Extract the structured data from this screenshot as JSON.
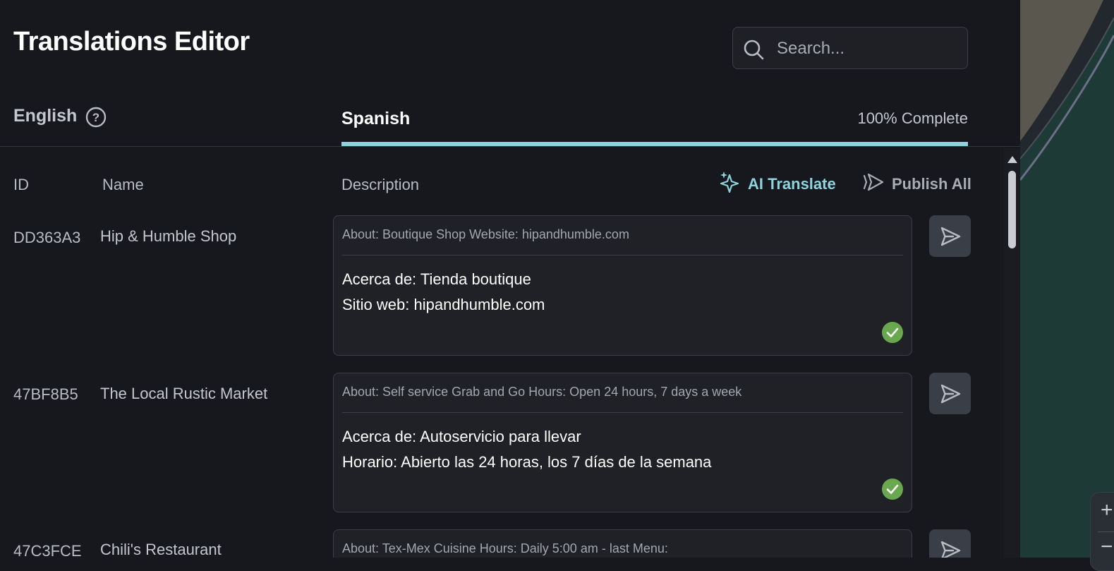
{
  "header": {
    "title": "Translations Editor",
    "search_placeholder": "Search..."
  },
  "languages": {
    "source": "English",
    "target": "Spanish",
    "completion": "100% Complete"
  },
  "columns": {
    "id": "ID",
    "name": "Name",
    "description": "Description"
  },
  "actions": {
    "ai_translate": "AI Translate",
    "publish_all": "Publish All"
  },
  "colors": {
    "accent": "#8fd3dc",
    "check": "#6aa84f",
    "background": "#16181d"
  },
  "rows": [
    {
      "id": "DD363A3",
      "name": "Hip & Humble Shop",
      "source": "About: Boutique Shop Website: hipandhumble.com",
      "translation": "Acerca de: Tienda boutique\nSitio web: hipandhumble.com",
      "status": "check-icon"
    },
    {
      "id": "47BF8B5",
      "name": "The Local Rustic Market",
      "source": "About: Self service Grab and Go Hours: Open 24 hours, 7 days a week",
      "translation": "Acerca de: Autoservicio para llevar\nHorario: Abierto las 24 horas, los 7 días de la semana",
      "status": "check-icon"
    },
    {
      "id": "47C3FCE",
      "name": "Chili's Restaurant",
      "source": "About: Tex-Mex Cuisine Hours: Daily 5:00 am - last Menu:",
      "translation": "",
      "status": ""
    }
  ]
}
